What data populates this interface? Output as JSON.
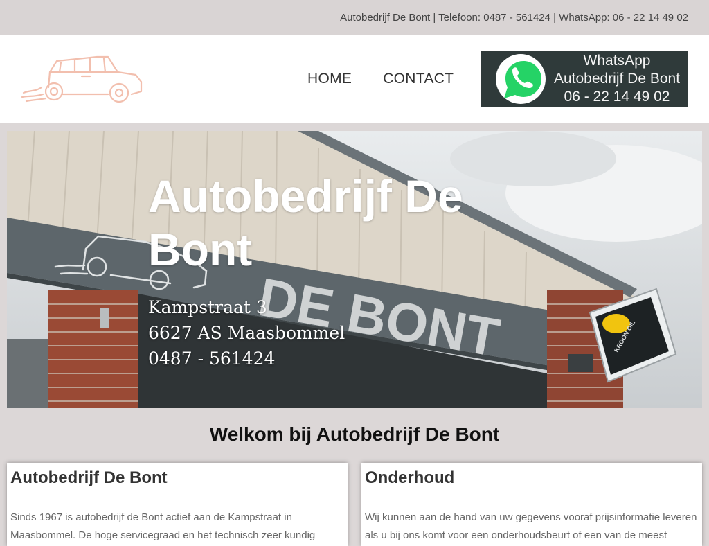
{
  "topbar": {
    "text": "Autobedrijf De Bont | Telefoon: 0487 - 561424 | WhatsApp: 06 - 22 14 49 02"
  },
  "nav": {
    "items": [
      {
        "label": "HOME"
      },
      {
        "label": "CONTACT"
      }
    ]
  },
  "whatsapp": {
    "line1": "WhatsApp",
    "line2": "Autobedrijf De Bont",
    "line3": "06 - 22 14 49 02"
  },
  "hero": {
    "title": "Autobedrijf De Bont",
    "address_line1": "Kampstraat 3",
    "address_line2": "6627 AS Maasbommel",
    "phone": "0487 - 561424",
    "sign_text": "DE BONT",
    "kroon_label": "KROON OIL"
  },
  "welcome": {
    "heading": "Welkom bij Autobedrijf De Bont"
  },
  "cards": [
    {
      "title": "Autobedrijf De Bont",
      "text": "Sinds 1967 is autobedrijf de Bont actief aan de Kampstraat in Maasbommel. De hoge servicegraad en het technisch zeer kundig"
    },
    {
      "title": "Onderhoud",
      "text": "Wij kunnen aan de hand van uw gegevens vooraf prijsinformatie leveren als u bij ons komt voor een onderhoudsbeurt of een van de meest"
    }
  ],
  "colors": {
    "topbar_bg": "#d9d4d4",
    "page_bg": "#dcd7d7",
    "whatsapp_bg": "#2f3a3a",
    "whatsapp_green": "#25d366",
    "logo_peach": "#f2bfae"
  }
}
